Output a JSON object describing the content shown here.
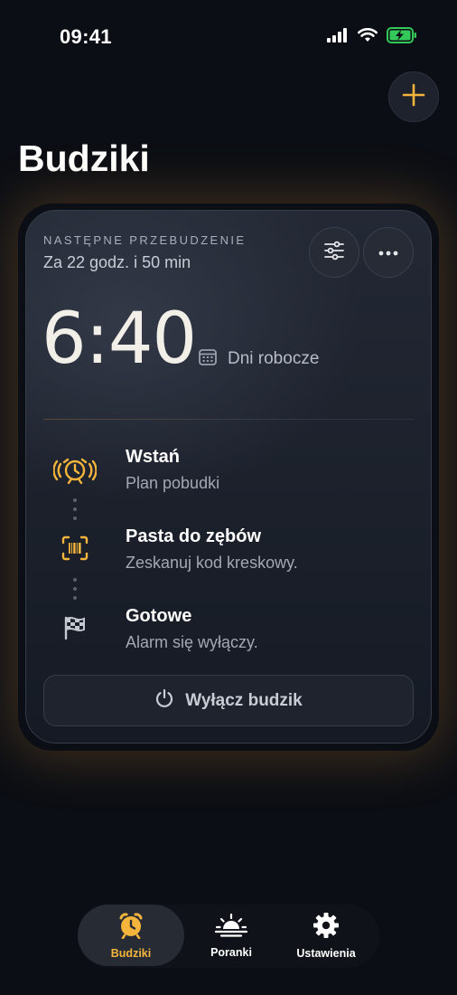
{
  "status_bar": {
    "time": "09:41"
  },
  "header": {
    "title": "Budziki"
  },
  "card": {
    "next_label": "NASTĘPNE PRZEBUDZENIE",
    "next_when": "Za 22 godz. i 50 min",
    "alarm_time": "6:40",
    "repeat": "Dni robocze",
    "steps": [
      {
        "title": "Wstań",
        "subtitle": "Plan pobudki",
        "icon": "alarm-ringing-icon"
      },
      {
        "title": "Pasta do zębów",
        "subtitle": "Zeskanuj kod kreskowy.",
        "icon": "barcode-scan-icon"
      },
      {
        "title": "Gotowe",
        "subtitle": "Alarm się wyłączy.",
        "icon": "checkered-flag-icon"
      }
    ],
    "off_button": "Wyłącz budzik"
  },
  "tabs": [
    {
      "label": "Budziki",
      "icon": "alarm-clock-icon",
      "active": true
    },
    {
      "label": "Poranki",
      "icon": "sunrise-icon",
      "active": false
    },
    {
      "label": "Ustawienia",
      "icon": "gear-icon",
      "active": false
    }
  ],
  "colors": {
    "accent": "#f5b43c",
    "background": "#0b0e14"
  }
}
